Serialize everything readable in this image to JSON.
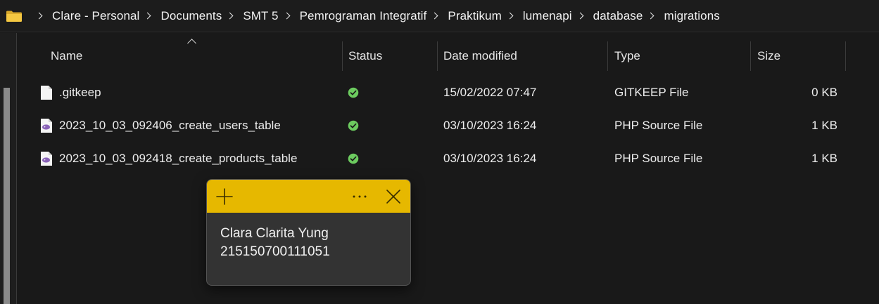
{
  "breadcrumb": {
    "items": [
      "Clare - Personal",
      "Documents",
      "SMT 5",
      "Pemrograman Integratif",
      "Praktikum",
      "lumenapi",
      "database",
      "migrations"
    ],
    "folder_icon": "folder-icon",
    "folder_color": "#f0c33c"
  },
  "columns": {
    "name": "Name",
    "status": "Status",
    "date_modified": "Date modified",
    "type": "Type",
    "size": "Size"
  },
  "files": [
    {
      "name": ".gitkeep",
      "status": "synced-check-icon",
      "date": "15/02/2022 07:47",
      "type": "GITKEEP File",
      "size": "0 KB",
      "icon": "blank-file-icon"
    },
    {
      "name": "2023_10_03_092406_create_users_table",
      "status": "synced-check-icon",
      "date": "03/10/2023 16:24",
      "type": "PHP Source File",
      "size": "1 KB",
      "icon": "php-file-icon"
    },
    {
      "name": "2023_10_03_092418_create_products_table",
      "status": "synced-check-icon",
      "date": "03/10/2023 16:24",
      "type": "PHP Source File",
      "size": "1 KB",
      "icon": "php-file-icon"
    }
  ],
  "sticky_note": {
    "lines": [
      "Clara Clarita Yung",
      "215150700111051"
    ],
    "bar_color": "#e6b800",
    "icons": [
      "plus-icon",
      "ellipsis-icon",
      "close-icon"
    ]
  },
  "colors": {
    "background": "#191919",
    "status_green": "#6ccb5f"
  }
}
